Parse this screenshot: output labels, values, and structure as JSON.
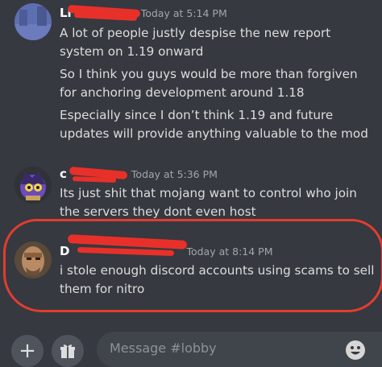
{
  "messages": [
    {
      "username": "Li",
      "timestamp": "Today at 5:14 PM",
      "lines": [
        "A lot of people justly despise the new report",
        "system on 1.19 onward",
        "So I think you guys would be more than forgiven",
        "for anchoring development around 1.18",
        "Especially since I don’t think 1.19 and future",
        "updates will provide anything valuable to the mod"
      ]
    },
    {
      "username": "c",
      "timestamp": "Today at 5:36 PM",
      "lines": [
        "Its just shit that mojang want to control who join",
        "the servers they dont even host"
      ]
    },
    {
      "username": "D",
      "timestamp": "Today at 8:14 PM",
      "lines": [
        "i stole enough discord accounts using scams to sell",
        "them for nitro"
      ]
    }
  ],
  "composer": {
    "placeholder": "Message #lobby",
    "add_icon": "plus-icon",
    "gift_icon": "gift-icon",
    "emoji_icon": "emoji-icon"
  },
  "colors": {
    "background": "#36393f",
    "annotation_red": "#e23d2f"
  }
}
